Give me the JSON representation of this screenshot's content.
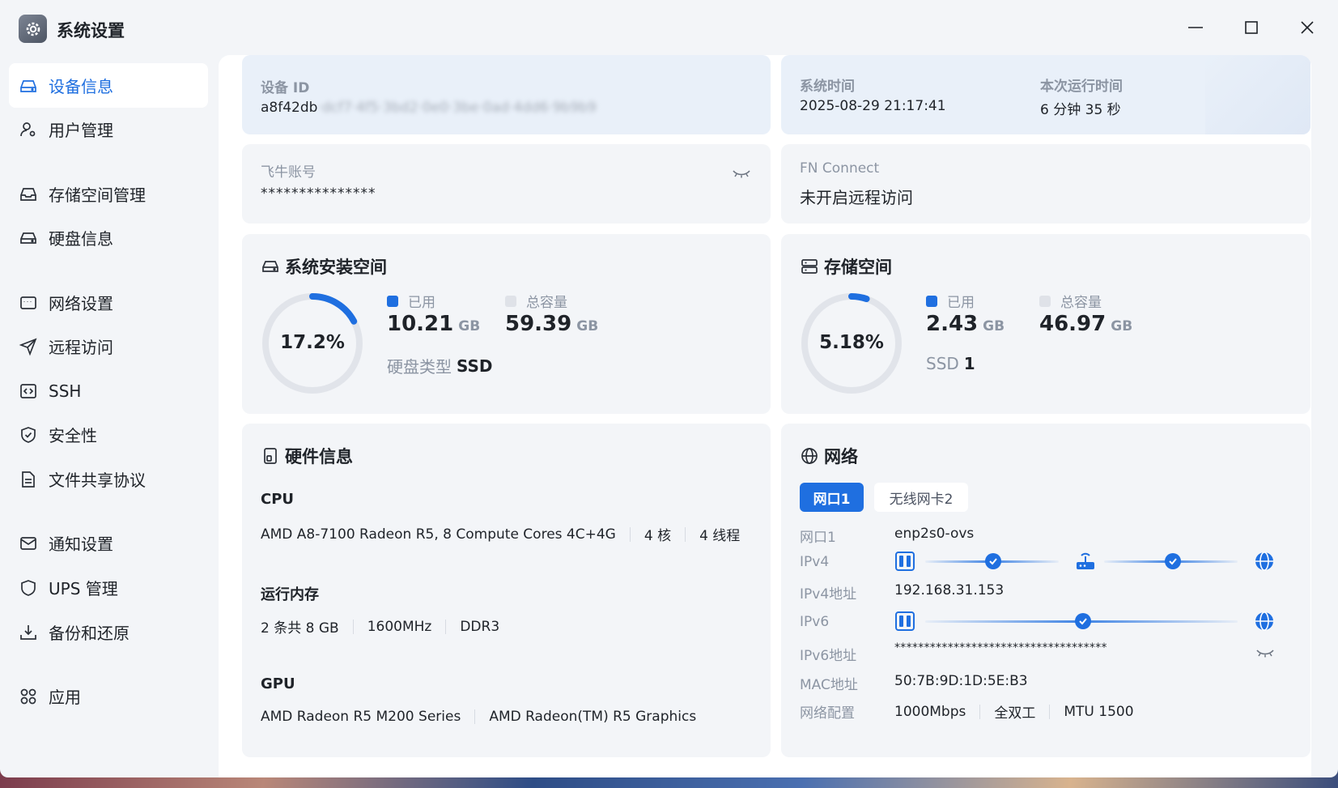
{
  "window": {
    "title": "系统设置"
  },
  "sidebar": {
    "items": [
      {
        "label": "设备信息",
        "icon": "device-icon"
      },
      {
        "label": "用户管理",
        "icon": "user-settings-icon"
      },
      {
        "label": "存储空间管理",
        "icon": "storage-icon"
      },
      {
        "label": "硬盘信息",
        "icon": "harddisk-icon"
      },
      {
        "label": "网络设置",
        "icon": "network-settings-icon"
      },
      {
        "label": "远程访问",
        "icon": "send-icon"
      },
      {
        "label": "SSH",
        "icon": "code-icon"
      },
      {
        "label": "安全性",
        "icon": "shield-icon"
      },
      {
        "label": "文件共享协议",
        "icon": "file-icon"
      },
      {
        "label": "通知设置",
        "icon": "mail-icon"
      },
      {
        "label": "UPS 管理",
        "icon": "ups-shield-icon"
      },
      {
        "label": "备份和还原",
        "icon": "download-icon"
      },
      {
        "label": "应用",
        "icon": "apps-icon"
      }
    ]
  },
  "device": {
    "id_label": "设备 ID",
    "id_value": "a8f42db",
    "id_value_blurred": "·dcf7·4f5·3bd2·0e0·3be·0ad·4dd6·9b9b9",
    "time_label": "系统时间",
    "time_value": "2025-08-29 21:17:41",
    "uptime_label": "本次运行时间",
    "uptime_value": "6 分钟 35 秒"
  },
  "account": {
    "label": "飞牛账号",
    "value": "***************"
  },
  "connect": {
    "label": "FN Connect",
    "value": "未开启远程访问"
  },
  "system_space": {
    "title": "系统安装空间",
    "percent_text": "17.2%",
    "percent": 17.2,
    "used_label": "已用",
    "used_value": "10.21",
    "total_label": "总容量",
    "total_value": "59.39",
    "unit": "GB",
    "disk_type_label": "硬盘类型",
    "disk_type_value": "SSD"
  },
  "storage_space": {
    "title": "存储空间",
    "percent_text": "5.18%",
    "percent": 5.18,
    "used_label": "已用",
    "used_value": "2.43",
    "total_label": "总容量",
    "total_value": "46.97",
    "unit": "GB",
    "ssd_label": "SSD",
    "ssd_value": "1"
  },
  "hardware": {
    "title": "硬件信息",
    "cpu_label": "CPU",
    "cpu_model": "AMD A8-7100 Radeon R5, 8 Compute Cores 4C+4G",
    "cpu_cores": "4 核",
    "cpu_threads": "4 线程",
    "ram_label": "运行内存",
    "ram_size": "2 条共 8 GB",
    "ram_freq": "1600MHz",
    "ram_type": "DDR3",
    "gpu_label": "GPU",
    "gpu_1": "AMD Radeon R5 M200 Series",
    "gpu_2": "AMD Radeon(TM) R5 Graphics"
  },
  "network": {
    "title": "网络",
    "tabs": [
      "网口1",
      "无线网卡2"
    ],
    "port_label": "网口1",
    "port_value": "enp2s0-ovs",
    "ipv4_label": "IPv4",
    "ipv4_addr_label": "IPv4地址",
    "ipv4_addr_value": "192.168.31.153",
    "ipv6_label": "IPv6",
    "ipv6_addr_label": "IPv6地址",
    "ipv6_addr_value": "************************************",
    "mac_label": "MAC地址",
    "mac_value": "50:7B:9D:1D:5E:B3",
    "config_label": "网络配置",
    "config_speed": "1000Mbps",
    "config_duplex": "全双工",
    "config_mtu": "MTU 1500"
  },
  "colors": {
    "accent": "#1f6fe0",
    "ring_track": "#e1e4ea",
    "card": "#f3f5f8",
    "card_blue": "#e9f0f9"
  }
}
